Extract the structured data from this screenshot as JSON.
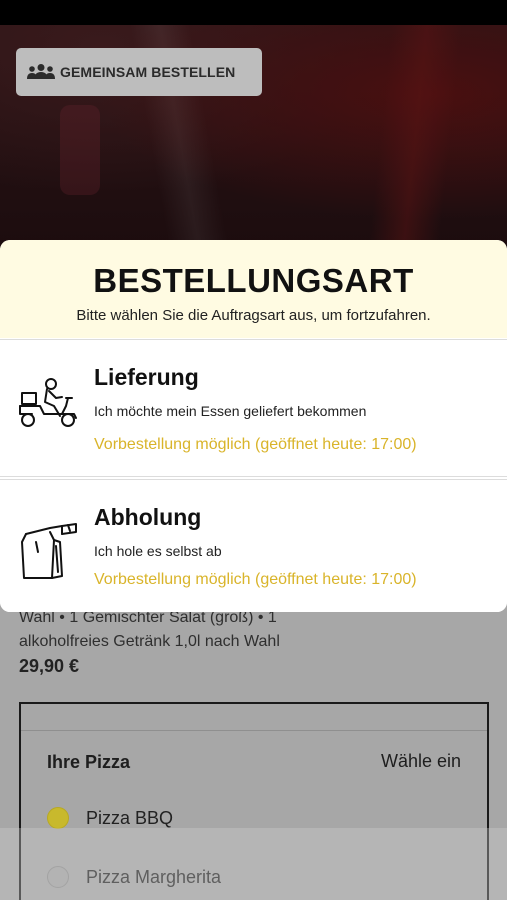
{
  "header": {
    "group_order_label": "GEMEINSAM BESTELLEN",
    "group_icon": "group-icon"
  },
  "modal": {
    "title": "BESTELLUNGSART",
    "subtitle": "Bitte wählen Sie die Auftragsart aus, um fortzufahren.",
    "options": [
      {
        "icon": "delivery-scooter-icon",
        "title": "Lieferung",
        "description": "Ich möchte mein Essen geliefert bekommen",
        "note": "Vorbestellung möglich (geöffnet heute: 17:00)"
      },
      {
        "icon": "pickup-bag-icon",
        "title": "Abholung",
        "description": "Ich hole es selbst ab",
        "note": "Vorbestellung möglich (geöffnet heute: 17:00)"
      }
    ],
    "accent_color": "#d9b42a"
  },
  "product": {
    "description_line1": "Wahl • 1 Gemischter Salat (groß) • 1",
    "description_line2": "alkoholfreies Getränk 1,0l nach Wahl",
    "price": "29,90 €"
  },
  "pizza_choice": {
    "title": "Ihre Pizza",
    "action": "Wähle ein",
    "options": [
      {
        "label": "Pizza BBQ",
        "selected": true
      },
      {
        "label": "Pizza Margherita",
        "selected": false
      }
    ]
  }
}
